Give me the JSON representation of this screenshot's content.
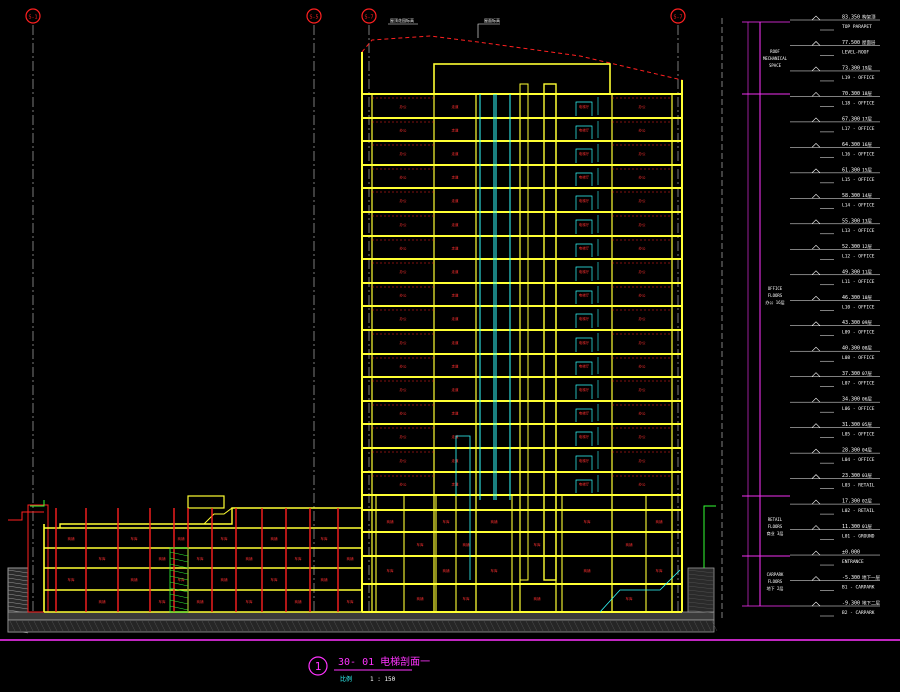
{
  "colors": {
    "background": "#000000",
    "wall": "#ffff33",
    "text_red": "#ff3030",
    "cyan": "#33ffff",
    "magenta": "#ff33ff",
    "white": "#ffffff",
    "green": "#33ff33",
    "grey": "#9a9a9a",
    "axis_red": "#ff2020"
  },
  "axes": [
    {
      "id": "axis-1",
      "label": "S-1"
    },
    {
      "id": "axis-2",
      "label": "S-5"
    },
    {
      "id": "axis-3",
      "label": "S-7"
    },
    {
      "id": "axis-4",
      "label": "S-7"
    }
  ],
  "roof_note": "屋顶花园标高",
  "roof_tag": "屋面标高",
  "levels": [
    {
      "elev": "83.350",
      "cn": "构架顶",
      "en": "TOP PARAPET"
    },
    {
      "elev": "77.500",
      "cn": "屋面层",
      "en": "LEVEL-ROOF"
    },
    {
      "elev": "73.300",
      "cn": "19层",
      "en": "L19 - OFFICE"
    },
    {
      "elev": "70.300",
      "cn": "18层",
      "en": "L18 - OFFICE"
    },
    {
      "elev": "67.300",
      "cn": "17层",
      "en": "L17 - OFFICE"
    },
    {
      "elev": "64.300",
      "cn": "16层",
      "en": "L16 - OFFICE"
    },
    {
      "elev": "61.300",
      "cn": "15层",
      "en": "L15 - OFFICE"
    },
    {
      "elev": "58.300",
      "cn": "14层",
      "en": "L14 - OFFICE"
    },
    {
      "elev": "55.300",
      "cn": "13层",
      "en": "L13 - OFFICE"
    },
    {
      "elev": "52.300",
      "cn": "12层",
      "en": "L12 - OFFICE"
    },
    {
      "elev": "49.300",
      "cn": "11层",
      "en": "L11 - OFFICE"
    },
    {
      "elev": "46.300",
      "cn": "10层",
      "en": "L10 - OFFICE"
    },
    {
      "elev": "43.300",
      "cn": "09层",
      "en": "L09 - OFFICE"
    },
    {
      "elev": "40.300",
      "cn": "08层",
      "en": "L08 - OFFICE"
    },
    {
      "elev": "37.300",
      "cn": "07层",
      "en": "L07 - OFFICE"
    },
    {
      "elev": "34.300",
      "cn": "06层",
      "en": "L06 - OFFICE"
    },
    {
      "elev": "31.300",
      "cn": "05层",
      "en": "L05 - OFFICE"
    },
    {
      "elev": "28.300",
      "cn": "04层",
      "en": "L04 - OFFICE"
    },
    {
      "elev": "23.300",
      "cn": "03层",
      "en": "L03 - RETAIL"
    },
    {
      "elev": "17.300",
      "cn": "02层",
      "en": "L02 - RETAIL"
    },
    {
      "elev": "11.300",
      "cn": "01层",
      "en": "L01 - GROUND"
    },
    {
      "elev": "±0.000",
      "cn": "",
      "en": "ENTRANCE"
    },
    {
      "elev": "-5.300",
      "cn": "地下一层",
      "en": "B1 - CARPARK"
    },
    {
      "elev": "-9.300",
      "cn": "地下二层",
      "en": "B2 - CARPARK"
    }
  ],
  "zones": [
    {
      "label": "ROOF\nMECHANICAL\nSPACE"
    },
    {
      "label": "OFFICE\nFLOORS\n办公 16层"
    },
    {
      "label": "RETAIL\nFLOORS\n商业 3层"
    },
    {
      "label": "CARPARK\nFLOORS\n地下 2层"
    }
  ],
  "tower_room_labels": [
    "办公",
    "走道",
    "电梯厅",
    "前室"
  ],
  "podium_room_labels": [
    "商铺",
    "商业",
    "车库",
    "设备"
  ],
  "title_block": {
    "number": "1",
    "title": "30- 01 电梯剖面一",
    "scale_label": "比例",
    "scale": "1 : 150"
  }
}
